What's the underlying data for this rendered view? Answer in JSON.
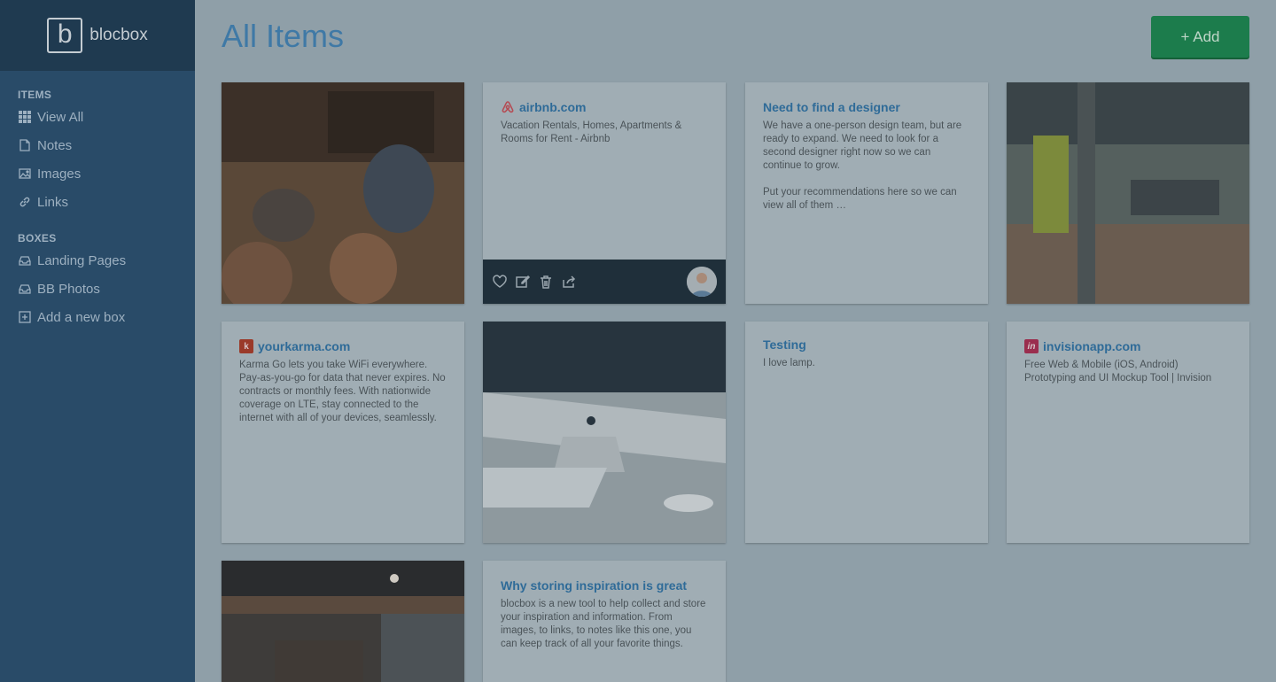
{
  "brand": {
    "mark": "b",
    "name": "blocbox"
  },
  "sidebar": {
    "items_label": "ITEMS",
    "items": [
      {
        "label": "View All",
        "icon": "grid-icon"
      },
      {
        "label": "Notes",
        "icon": "note-icon"
      },
      {
        "label": "Images",
        "icon": "image-icon"
      },
      {
        "label": "Links",
        "icon": "link-icon"
      }
    ],
    "boxes_label": "BOXES",
    "boxes": [
      {
        "label": "Landing Pages",
        "icon": "inbox-icon"
      },
      {
        "label": "BB Photos",
        "icon": "inbox-icon"
      },
      {
        "label": "Add a new box",
        "icon": "plus-square-icon"
      }
    ]
  },
  "header": {
    "title": "All Items",
    "add_label": "+ Add"
  },
  "cards": {
    "airbnb": {
      "title": "airbnb.com",
      "text": "Vacation Rentals, Homes, Apartments & Rooms for Rent - Airbnb"
    },
    "designer": {
      "title": "Need to find a designer",
      "p1": "We have a one-person design team, but are ready to expand. We need to look for a second designer right now so we can continue to grow.",
      "p2": "Put your recommendations here so we can view all of them …"
    },
    "karma": {
      "title": "yourkarma.com",
      "favicon": "k",
      "text": "Karma Go lets you take WiFi everywhere. Pay-as-you-go for data that never expires. No contracts or monthly fees. With nationwide coverage on LTE, stay connected to the internet with all of your devices, seamlessly."
    },
    "testing": {
      "title": "Testing",
      "text": "I love lamp."
    },
    "invision": {
      "title": "invisionapp.com",
      "favicon": "in",
      "text": "Free Web & Mobile (iOS, Android) Prototyping and UI Mockup Tool | Invision"
    },
    "inspiration": {
      "title": "Why storing inspiration is great",
      "text": "blocbox is a new tool to help collect and store your inspiration and information. From images, to links, to notes like this one, you can keep track of all your favorite things."
    }
  },
  "colors": {
    "accent": "#3f79a6",
    "add_button": "#1c7c4c",
    "sidebar": "#294b68"
  }
}
